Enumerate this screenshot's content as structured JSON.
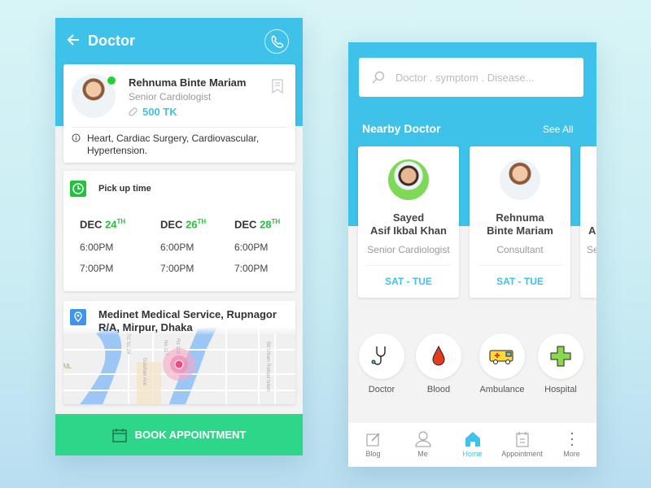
{
  "left": {
    "header": {
      "title": "Doctor",
      "back_icon": "arrow-left-icon",
      "call_icon": "phone-icon"
    },
    "doctor": {
      "name": "Rehnuma Binte Mariam",
      "title": "Senior Cardiologist",
      "fee": "500 TK",
      "status": "online",
      "specialties": "Heart, Cardiac Surgery, Cardiovascular,",
      "specialties2": "Hypertension."
    },
    "pickup": {
      "label": "Pick up time",
      "dates": [
        {
          "month": "DEC",
          "day": "24",
          "suffix": "TH",
          "times": [
            "6:00PM",
            "7:00PM"
          ]
        },
        {
          "month": "DEC",
          "day": "26",
          "suffix": "TH",
          "times": [
            "6:00PM",
            "7:00PM"
          ]
        },
        {
          "month": "DEC",
          "day": "28",
          "suffix": "TH",
          "times": [
            "6:00PM",
            "7:00PM"
          ]
        }
      ]
    },
    "location": {
      "line1": "Medinet Medical Service, Rupnagor",
      "line2": "R/A, Mirpur, Dhaka",
      "map_labels": [
        "Rd No 24",
        "Gulshan Ave",
        "No 117",
        "Rd 118",
        "Bir Uttam Rafiqul Islam",
        "AIL"
      ]
    },
    "book_label": "BOOK APPOINTMENT"
  },
  "right": {
    "search": {
      "placeholder": "Doctor . symptom . Disease..."
    },
    "nearby": {
      "title": "Nearby Doctor",
      "see_all": "See All",
      "doctors": [
        {
          "name1": "Sayed",
          "name2": "Asif Ikbal Khan",
          "title": "Senior Cardiologist",
          "days": "SAT - TUE"
        },
        {
          "name1": "Rehnuma",
          "name2": "Binte Mariam",
          "title": "Consultant",
          "days": "SAT - TUE"
        },
        {
          "name1": "A",
          "name2": "",
          "title": "Se",
          "days": ""
        }
      ]
    },
    "services": [
      {
        "label": "Doctor",
        "icon": "stethoscope-icon"
      },
      {
        "label": "Blood",
        "icon": "blood-drop-icon"
      },
      {
        "label": "Ambulance",
        "icon": "ambulance-icon"
      },
      {
        "label": "Hospital",
        "icon": "hospital-cross-icon"
      }
    ],
    "nav": [
      {
        "label": "Blog"
      },
      {
        "label": "Me"
      },
      {
        "label": "Home",
        "active": true
      },
      {
        "label": "Appointment"
      },
      {
        "label": "More"
      }
    ]
  },
  "colors": {
    "primary": "#3ec2ea",
    "accent_green": "#2ed68a",
    "date_green": "#22c33c"
  }
}
